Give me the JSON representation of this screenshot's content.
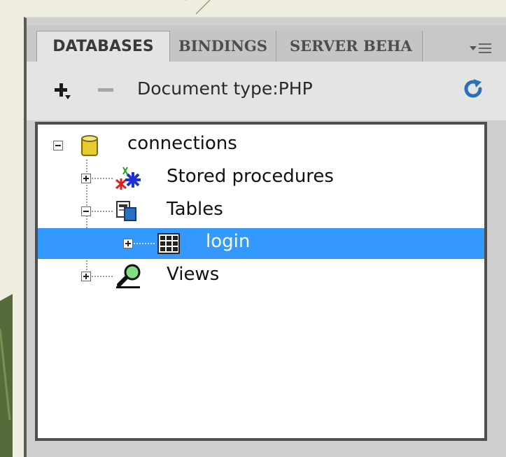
{
  "tabs": [
    {
      "label": "DATABASES",
      "active": true
    },
    {
      "label": "BINDINGS",
      "active": false
    },
    {
      "label": "SERVER BEHA",
      "active": false
    }
  ],
  "toolbar": {
    "document_type": "Document type:PHP"
  },
  "tree": {
    "root": {
      "label": "connections",
      "icon": "database-cylinder-icon"
    },
    "items": [
      {
        "label": "Stored procedures",
        "icon": "stored-procedures-icon",
        "expanded": false
      },
      {
        "label": "Tables",
        "icon": "tables-icon",
        "expanded": true
      },
      {
        "label": "login",
        "icon": "table-grid-icon",
        "expanded": false,
        "selected": true
      },
      {
        "label": "Views",
        "icon": "views-icon",
        "expanded": false
      }
    ]
  },
  "colors": {
    "selection": "#3399ff",
    "panel_bg": "#e4e4e4",
    "refresh_icon": "#2a6fb8"
  }
}
